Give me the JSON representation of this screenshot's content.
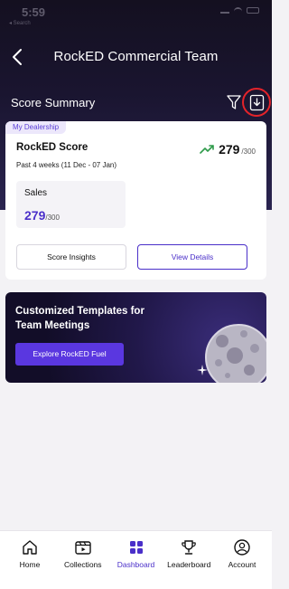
{
  "status_bar": {
    "time": "5:59",
    "carrier": "◂ Search"
  },
  "header": {
    "title": "RockED Commercial Team",
    "back_icon": "chevron-left-icon"
  },
  "section": {
    "title": "Score Summary",
    "filter_icon": "filter-icon",
    "download_icon": "download-icon"
  },
  "score_card": {
    "tag": "My Dealership",
    "label": "RockED Score",
    "period": "Past 4 weeks (11 Dec - 07 Jan)",
    "score": "279",
    "max": "/300",
    "trend_icon": "trending-up-icon",
    "trend_color": "#2e9b4a",
    "sales": {
      "label": "Sales",
      "value": "279",
      "max": "/300"
    },
    "buttons": {
      "insights": "Score Insights",
      "details": "View Details"
    }
  },
  "promo": {
    "title": "Customized Templates for Team Meetings",
    "button": "Explore RockED Fuel"
  },
  "bottom_nav": {
    "items": [
      {
        "label": "Home",
        "icon": "home-icon"
      },
      {
        "label": "Collections",
        "icon": "collections-icon"
      },
      {
        "label": "Dashboard",
        "icon": "dashboard-icon"
      },
      {
        "label": "Leaderboard",
        "icon": "trophy-icon"
      },
      {
        "label": "Account",
        "icon": "account-icon"
      }
    ],
    "active": "Dashboard"
  },
  "colors": {
    "accent": "#4a2fc9",
    "highlight": "#e3232a"
  }
}
